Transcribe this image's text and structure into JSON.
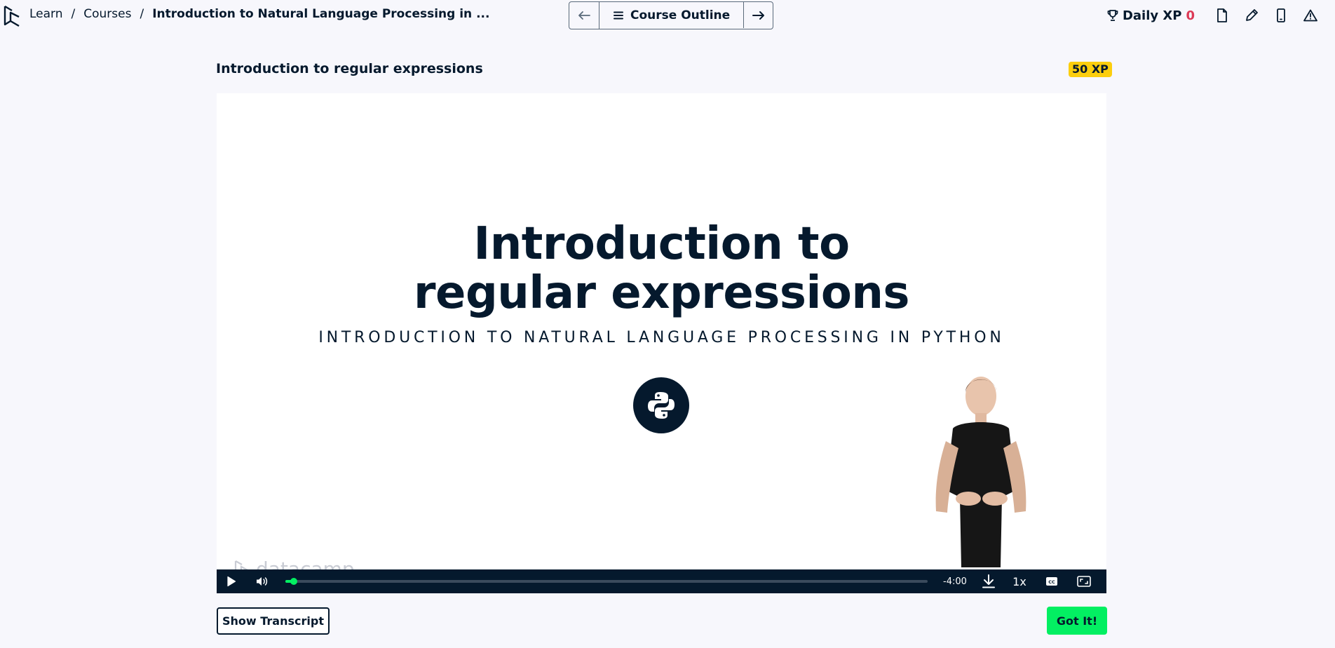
{
  "breadcrumb": {
    "items": [
      "Learn",
      "Courses"
    ],
    "separator": "/",
    "current": "Introduction to Natural Language Processing in ..."
  },
  "nav": {
    "prev_icon": "arrow-left-icon",
    "outline_label": "Course Outline",
    "outline_icon": "menu-icon",
    "next_icon": "arrow-right-icon"
  },
  "header_right": {
    "daily_xp_label": "Daily XP",
    "daily_xp_value": "0",
    "trophy_icon": "trophy-icon",
    "tools": [
      "document-icon",
      "pencil-icon",
      "mobile-icon",
      "warning-icon"
    ]
  },
  "lesson": {
    "title": "Introduction to regular expressions",
    "xp_badge": "50 XP"
  },
  "video": {
    "slide_title_line1": "Introduction to",
    "slide_title_line2": "regular expressions",
    "slide_subtitle": "INTRODUCTION TO NATURAL LANGUAGE PROCESSING IN PYTHON",
    "watermark": "datacamp",
    "time_remaining": "-4:00",
    "speed": "1x",
    "progress": 0.01
  },
  "buttons": {
    "transcript": "Show Transcript",
    "got_it": "Got It!"
  },
  "colors": {
    "navy": "#05192d",
    "green": "#03ef62",
    "yellow": "#fcce0d",
    "red": "#dc3a56",
    "background": "#f7f7fc"
  }
}
